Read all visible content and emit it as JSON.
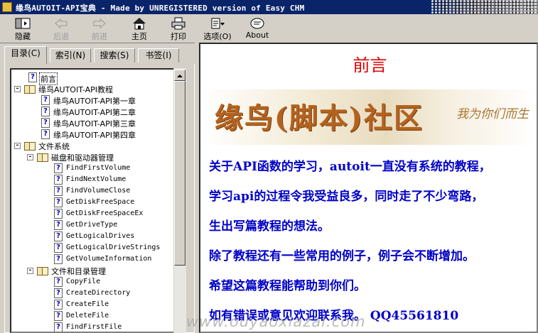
{
  "window": {
    "title": "缘鸟AUTOIT-API宝典 - Made by UNREGISTERED version of Easy CHM"
  },
  "toolbar": {
    "hide": "隐藏",
    "back": "后退",
    "forward": "前进",
    "home": "主页",
    "print": "打印",
    "options": "选项(O)",
    "about": "About"
  },
  "tabs": [
    "目录(C)",
    "索引(N)",
    "搜索(S)",
    "书签(I)"
  ],
  "tree": [
    {
      "label": "前言",
      "icon": "help-page-icon",
      "selected": true
    },
    {
      "label": "缘鸟AUTOIT-API教程",
      "icon": "book-icon",
      "expander": "-"
    },
    {
      "label": "缘鸟AUTOIT-API第一章",
      "icon": "help-page-icon"
    },
    {
      "label": "缘鸟AUTOIT-API第二章",
      "icon": "help-page-icon"
    },
    {
      "label": "缘鸟AUTOIT-API第三章",
      "icon": "help-page-icon"
    },
    {
      "label": "缘鸟AUTOIT-API第四章",
      "icon": "help-page-icon"
    },
    {
      "label": "文件系统",
      "icon": "book-icon",
      "expander": "-"
    },
    {
      "label": "磁盘和驱动器管理",
      "icon": "book-icon",
      "expander": "-"
    },
    {
      "label": "FindFirstVolume",
      "icon": "help-page-icon"
    },
    {
      "label": "FindNextVolume",
      "icon": "help-page-icon"
    },
    {
      "label": "FindVolumeClose",
      "icon": "help-page-icon"
    },
    {
      "label": "GetDiskFreeSpace",
      "icon": "help-page-icon"
    },
    {
      "label": "GetDiskFreeSpaceEx",
      "icon": "help-page-icon"
    },
    {
      "label": "GetDriveType",
      "icon": "help-page-icon"
    },
    {
      "label": "GetLogicalDrives",
      "icon": "help-page-icon"
    },
    {
      "label": "GetLogicalDriveStrings",
      "icon": "help-page-icon"
    },
    {
      "label": "GetVolumeInformation",
      "icon": "help-page-icon"
    },
    {
      "label": "文件和目录管理",
      "icon": "book-icon",
      "expander": "-"
    },
    {
      "label": "CopyFile",
      "icon": "help-page-icon"
    },
    {
      "label": "CreateDirectory",
      "icon": "help-page-icon"
    },
    {
      "label": "CreateFile",
      "icon": "help-page-icon"
    },
    {
      "label": "DeleteFile",
      "icon": "help-page-icon"
    },
    {
      "label": "FindFirstFile",
      "icon": "help-page-icon"
    }
  ],
  "content": {
    "heading": "前言",
    "banner_title": "缘鸟(脚本)社区",
    "banner_slogan": "我为你们而生",
    "paragraphs": [
      "关于API函数的学习，autoit一直没有系统的教程，",
      "学习api的过程令我受益良多，同时走了不少弯路，",
      "生出写篇教程的想法。",
      "除了教程还有一些常用的例子，例子会不断增加。",
      "希望这篇教程能帮助到你们。",
      "如有错误或意见欢迎联系我。  QQ45561810"
    ]
  },
  "watermark": "www.ouyaoxiazai.com"
}
